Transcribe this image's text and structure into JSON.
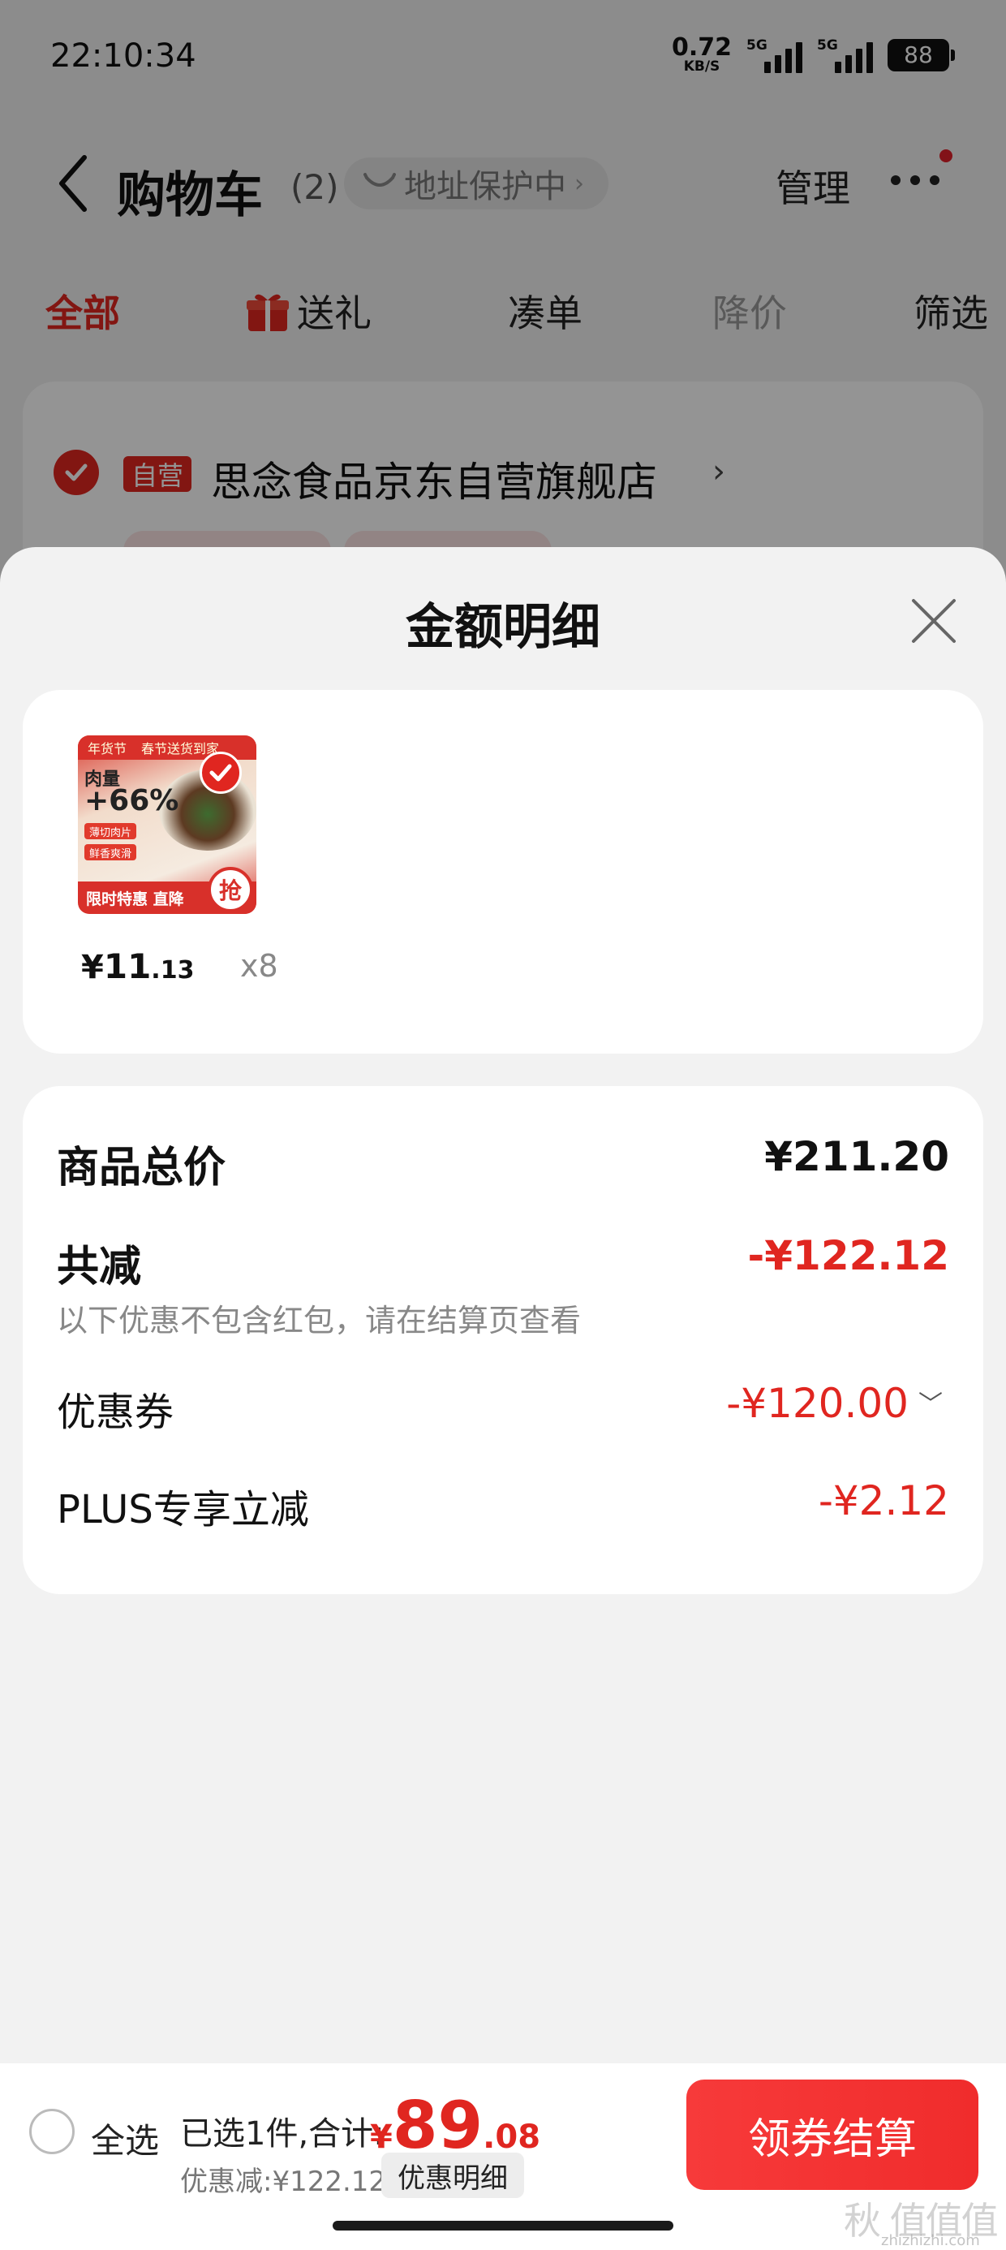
{
  "status_bar": {
    "time": "22:10:34",
    "net_speed_value": "0.72",
    "net_speed_unit": "KB/S",
    "signal1_label": "5G",
    "signal2_label": "5G",
    "battery": "88"
  },
  "header": {
    "title": "购物车",
    "count": "(2)",
    "address_pill": "地址保护中",
    "manage": "管理"
  },
  "tabs": [
    {
      "label": "全部"
    },
    {
      "label": "送礼"
    },
    {
      "label": "凑单"
    },
    {
      "label": "降价"
    },
    {
      "label": "筛选"
    }
  ],
  "store": {
    "badge": "自营",
    "name": "思念食品京东自营旗舰店"
  },
  "sheet": {
    "title": "金额明细"
  },
  "product": {
    "thumb": {
      "top_text_1": "年货节",
      "top_text_2": "春节送货到家",
      "meat_label": "肉量",
      "meat_value": "+66%",
      "tag1": "薄切肉片",
      "tag2": "鲜香爽滑",
      "bottom_text": "限时特惠 直降",
      "grab": "抢"
    },
    "price_symbol": "¥",
    "price_int": "11",
    "price_dec": ".13",
    "quantity": "x8"
  },
  "summary": {
    "total_label": "商品总价",
    "total_value": "¥211.20",
    "reduce_label": "共减",
    "reduce_value": "-¥122.12",
    "note": "以下优惠不包含红包，请在结算页查看",
    "coupon_label": "优惠券",
    "coupon_value": "-¥120.00",
    "plus_label": "PLUS专享立减",
    "plus_value": "-¥2.12"
  },
  "bottom_bar": {
    "select_all": "全选",
    "selected_text": "已选1件,合计:",
    "price_symbol": "¥",
    "price_int": "89",
    "price_dec": ".08",
    "discount_text": "优惠减:¥122.12",
    "detail_button": "优惠明细",
    "checkout_button": "领券结算"
  },
  "watermark": {
    "text": "秋 值值值",
    "sub": "zhizhizhi.com"
  },
  "colors": {
    "accent_red": "#e02620",
    "checkout_red": "#f73a3a"
  },
  "icons": [
    "back-icon",
    "shield-icon",
    "more-icon",
    "gift-icon",
    "check-icon",
    "close-icon",
    "chevron-down-icon"
  ]
}
